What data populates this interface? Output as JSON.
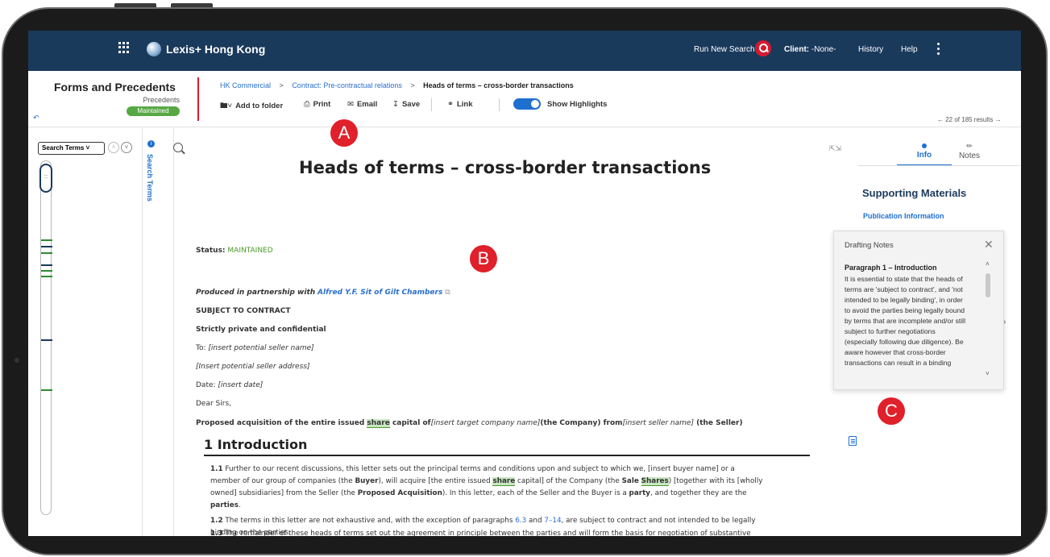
{
  "topbar": {
    "brand": "Lexis+ Hong Kong",
    "run_new_search": "Run New Search",
    "client_label": "Client:",
    "client_value": "-None-",
    "history": "History",
    "help": "Help"
  },
  "header": {
    "title": "Forms and Precedents",
    "subtitle": "Precedents",
    "badge": "Maintained",
    "breadcrumbs": [
      "HK Commercial",
      "Contract: Pre-contractual relations",
      "Heads of terms – cross-border transactions"
    ],
    "breadcrumb_sep": ">",
    "toolbar": {
      "add_to_folder": "Add to folder",
      "print": "Print",
      "email": "Email",
      "save": "Save",
      "link": "Link",
      "show_highlights": "Show Highlights"
    },
    "results_nav": "←  22 of 185 results  →"
  },
  "left_rail": {
    "search_terms_select": "Search Terms",
    "vertical_label": "Search Terms"
  },
  "document": {
    "title": "Heads of terms – cross-border transactions",
    "status_label": "Status:",
    "status_value": "MAINTAINED",
    "produced_prefix": "Produced in partnership with",
    "produced_link": "Alfred Y.F. Sit of Gilt Chambers",
    "subject_to_contract": "SUBJECT TO CONTRACT",
    "strictly_private": "Strictly private and confidential",
    "to_prefix": "To: ",
    "to_value": "[insert potential seller name]",
    "address": "[Insert potential seller address]",
    "date_prefix": "Date: ",
    "date_value": "[insert date]",
    "salutation": "Dear Sirs,",
    "proposed": {
      "a": "Proposed acquisition of the entire issued ",
      "share": "share",
      "b": " capital of",
      "c": "[insert target company name]",
      "d": "(the Company) from",
      "e": "[insert seller name]",
      "f": " (the Seller)"
    },
    "section_heading": "1 Introduction",
    "p11": {
      "num": "1.1",
      "t1": " Further to our recent discussions, this letter sets out the principal terms and conditions upon and subject to which we, [insert buyer name] or a",
      "t2a": "member of our group of companies (the ",
      "buyer": "Buyer",
      "t2b": "), will acquire [the entire issued ",
      "share": "share",
      "t2c": " capital] of the Company (the ",
      "sale": "Sale",
      "shares": "Shares",
      "t2d": ") [together with its [wholly",
      "t3a": "owned] subsidiaries] from the Seller (the ",
      "proposed_acq": "Proposed Acquisition",
      "t3b": "). In this letter, each of the Seller and the Buyer is a ",
      "party": "party",
      "t3c": ", and together they are the",
      "parties": "parties",
      "t4": "."
    },
    "p12": {
      "num": "1.2",
      "t1": " The terms in this letter are not exhaustive and, with the exception of paragraphs ",
      "ref1": "6.3",
      "and": " and ",
      "ref2": "7–14",
      "t2": ", are subject to contract and not intended to be legally",
      "t3": "binding on the parties."
    },
    "p13": {
      "num": "1.3",
      "t1": " The remainder of these heads of terms set out the agreement in principle between the parties and will form the basis for negotiation of substantive"
    }
  },
  "right_panel": {
    "tab_info": "Info",
    "tab_notes": "Notes",
    "supporting_materials": "Supporting Materials",
    "publication_information": "Publication Information"
  },
  "drafting_notes": {
    "title": "Drafting Notes",
    "heading": "Paragraph 1 – Introduction",
    "lines": [
      "It is essential to state that the heads of",
      "terms are 'subject to contract', and 'not",
      "intended to be legally binding', in order",
      "to avoid the parties being legally bound",
      "by terms that are incomplete and/or still",
      "subject to further negotiations",
      "(especially following due diligence). Be",
      "aware however that cross-border",
      "transactions can result in a binding"
    ]
  },
  "markers": [
    "A",
    "B",
    "C"
  ],
  "colors": {
    "nav_bg": "#1a3a5c",
    "accent_blue": "#1f6fd1",
    "accent_red": "#d7192f",
    "maintained_green": "#57a845"
  }
}
